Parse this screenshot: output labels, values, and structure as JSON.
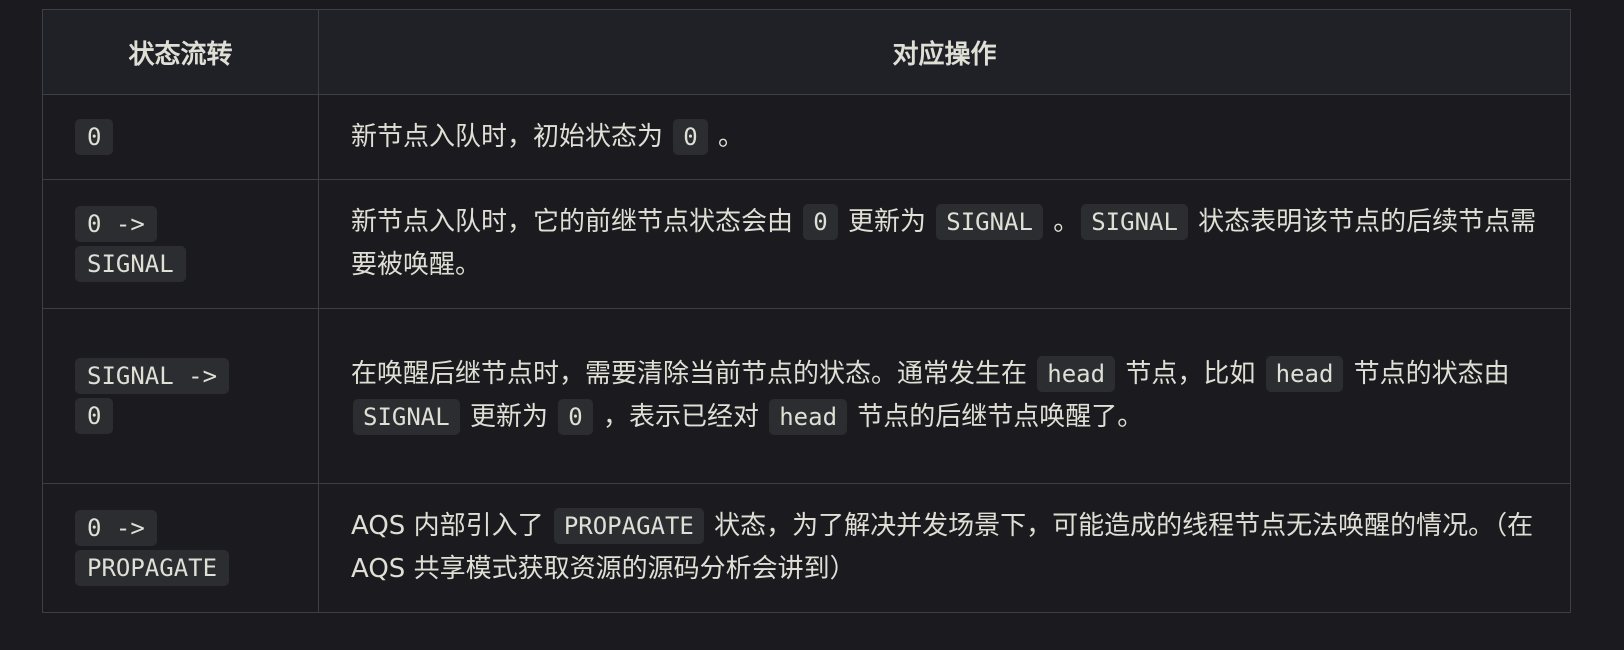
{
  "table": {
    "headers": [
      "状态流转",
      "对应操作"
    ],
    "rows": [
      {
        "flow": "0",
        "desc": [
          "新节点入队时，初始状态为 ",
          {
            "code": "0"
          },
          " 。"
        ]
      },
      {
        "flow": "0 -> SIGNAL",
        "desc": [
          "新节点入队时，它的前继节点状态会由 ",
          {
            "code": "0"
          },
          " 更新为 ",
          {
            "code": "SIGNAL"
          },
          " 。",
          {
            "code": "SIGNAL"
          },
          " 状态表明该节点的后续节点需要被唤醒。"
        ]
      },
      {
        "flow": "SIGNAL -> 0",
        "desc": [
          "在唤醒后继节点时，需要清除当前节点的状态。通常发生在 ",
          {
            "code": "head"
          },
          " 节点，比如 ",
          {
            "code": "head"
          },
          " 节点的状态由 ",
          {
            "code": "SIGNAL"
          },
          " 更新为 ",
          {
            "code": "0"
          },
          " ，表示已经对 ",
          {
            "code": "head"
          },
          " 节点的后继节点唤醒了。"
        ]
      },
      {
        "flow": "0 -> PROPAGATE",
        "desc": [
          "AQS 内部引入了 ",
          {
            "code": "PROPAGATE"
          },
          " 状态，为了解决并发场景下，可能造成的线程节点无法唤醒的情况。（在 AQS 共享模式获取资源的源码分析会讲到）"
        ]
      }
    ]
  }
}
